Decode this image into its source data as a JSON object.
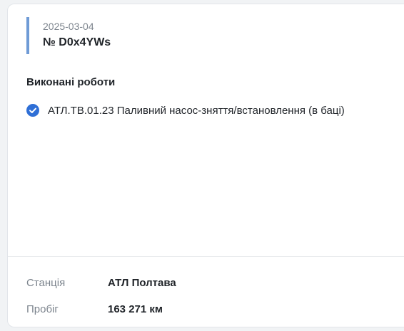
{
  "record": {
    "date": "2025-03-04",
    "number": "№ D0x4YWs"
  },
  "works": {
    "title": "Виконані роботи",
    "items": [
      {
        "label": "АТЛ.ТВ.01.23 Паливний насос-зняття/встановлення (в баці)",
        "icon": "check-circle-icon"
      }
    ]
  },
  "info": {
    "station_label": "Станція",
    "station_value": "АТЛ Полтава",
    "mileage_label": "Пробіг",
    "mileage_value": "163 271 км"
  },
  "colors": {
    "accent": "#6f9bd6",
    "check": "#2f6fd6"
  }
}
